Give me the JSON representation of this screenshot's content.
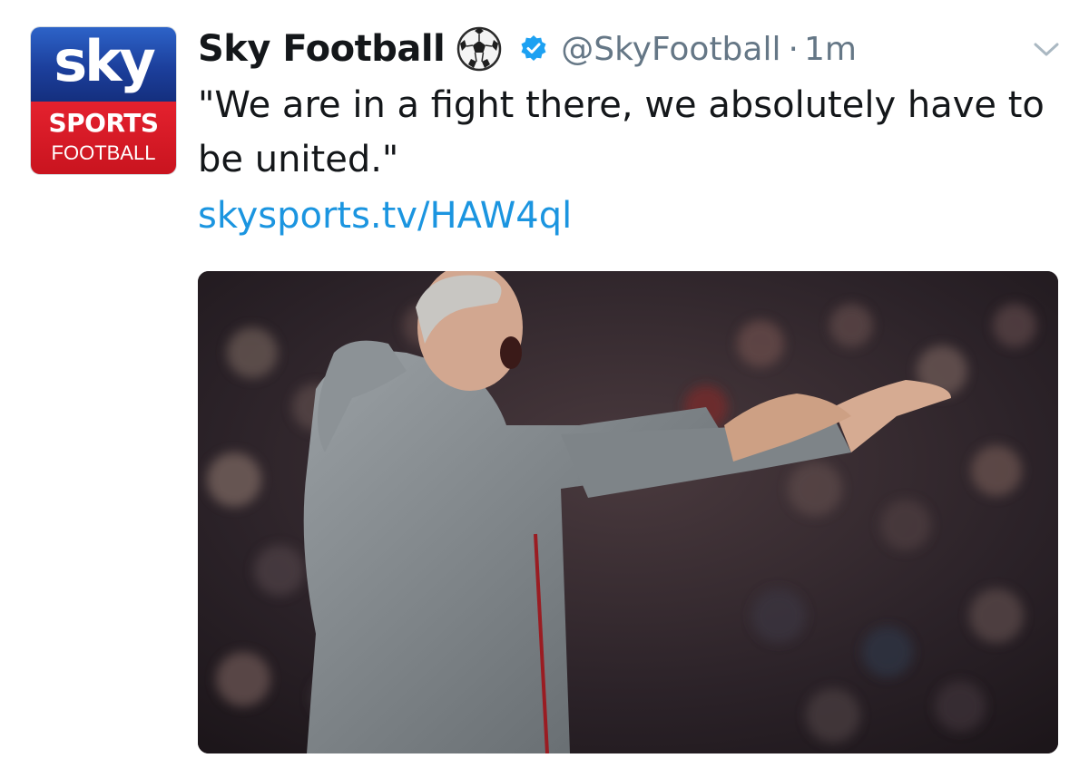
{
  "account": {
    "display_name": "Sky Football",
    "handle": "@SkyFootball",
    "separator": "·",
    "timestamp": "1m",
    "avatar": {
      "line1": "sky",
      "line2": "SPORTS",
      "line3": "FOOTBALL"
    }
  },
  "tweet": {
    "text": "\"We are in a fight there, we absolutely have to be united.\"",
    "link": "skysports.tv/HAW4ql"
  },
  "icons": {
    "emoji": "soccer-ball-icon",
    "verified": "verified-badge-icon",
    "menu": "chevron-down-icon"
  },
  "colors": {
    "text": "#14171a",
    "secondary": "#657786",
    "link": "#1b95e0",
    "verified": "#1da1f2",
    "sky_blue": "#1c3f9c",
    "sky_red": "#d8192a"
  }
}
